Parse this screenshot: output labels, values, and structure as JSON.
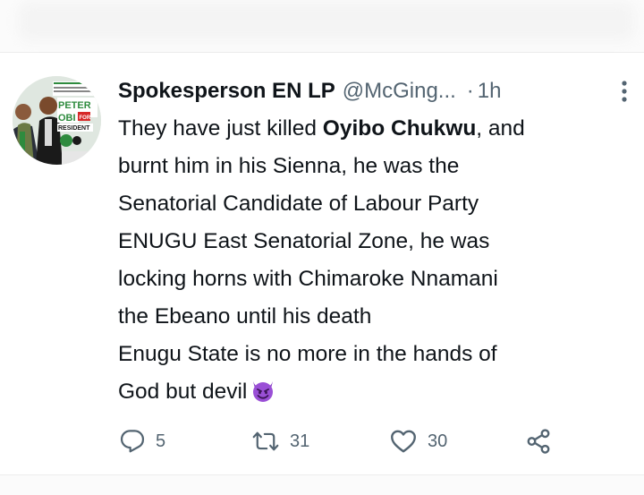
{
  "tweet": {
    "display_name": "Spokesperson EN LP",
    "handle": "@McGing...",
    "separator": "·",
    "time": "1h",
    "text_lines": [
      {
        "before": "They have just killed ",
        "bold": "Oyibo Chukwu",
        "after": ", and"
      },
      "burnt him in his Sienna, he was the",
      "Senatorial Candidate of Labour Party",
      "ENUGU East Senatorial Zone, he was",
      "locking horns with Chimaroke Nnamani",
      "the Ebeano until his death",
      "Enugu State is no more in the hands of",
      "God but devil"
    ],
    "emoji": "smiling-devil-emoji"
  },
  "avatar": {
    "poster_text": [
      "PETER",
      "OBI",
      "FOR",
      "RESIDENT"
    ]
  },
  "actions": {
    "replies": "5",
    "retweets": "31",
    "likes": "30"
  },
  "icons": {
    "reply": "reply-icon",
    "retweet": "retweet-icon",
    "like": "heart-icon",
    "share": "share-icon",
    "more": "more-icon"
  },
  "colors": {
    "text": "#0f1419",
    "secondary": "#536471",
    "emoji": "#9a4fd6"
  }
}
